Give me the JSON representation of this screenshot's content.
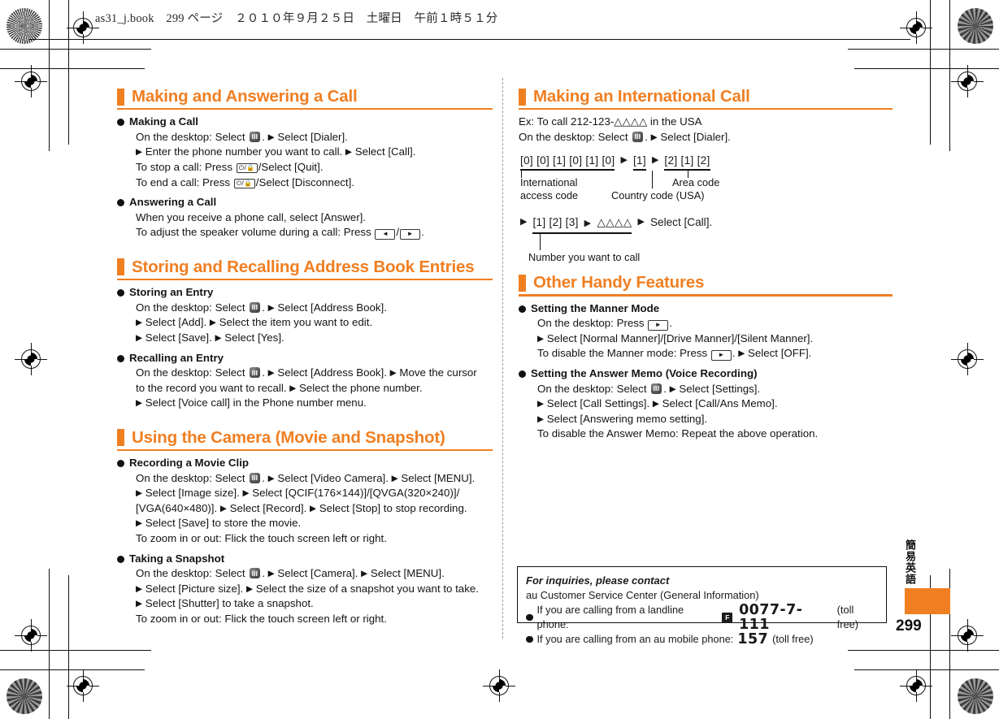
{
  "document": {
    "header_line": "as31_j.book　299 ページ　２０１０年９月２５日　土曜日　午前１時５１分",
    "page_number": "299",
    "side_tab_label": "簡易英語",
    "accent_color": "#F07F22"
  },
  "left_column": [
    {
      "heading": "Making and Answering a Call",
      "groups": [
        {
          "title": "Making a Call",
          "lines": [
            {
              "parts": [
                {
                  "t": "On the desktop: Select "
                },
                {
                  "icon": "menu-key"
                },
                {
                  "t": ". "
                },
                {
                  "tri": true
                },
                {
                  "t": " Select [Dialer]."
                }
              ]
            },
            {
              "parts": [
                {
                  "tri": true
                },
                {
                  "t": " Enter the phone number you want to call. "
                },
                {
                  "tri": true
                },
                {
                  "t": " Select [Call]."
                }
              ]
            },
            {
              "parts": [
                {
                  "t": "To stop a call: Press "
                },
                {
                  "icon": "power-key"
                },
                {
                  "t": "/Select [Quit]."
                }
              ]
            },
            {
              "parts": [
                {
                  "t": "To end a call: Press "
                },
                {
                  "icon": "power-key"
                },
                {
                  "t": "/Select [Disconnect]."
                }
              ]
            }
          ]
        },
        {
          "title": "Answering a Call",
          "lines": [
            {
              "parts": [
                {
                  "t": "When you receive a phone call, select [Answer]."
                }
              ]
            },
            {
              "parts": [
                {
                  "t": "To adjust the speaker volume during a call: Press "
                },
                {
                  "icon": "left-key"
                },
                {
                  "t": "/"
                },
                {
                  "icon": "right-key"
                },
                {
                  "t": "."
                }
              ]
            }
          ]
        }
      ]
    },
    {
      "heading": "Storing and Recalling Address Book Entries",
      "groups": [
        {
          "title": "Storing an Entry",
          "lines": [
            {
              "parts": [
                {
                  "t": "On the desktop: Select "
                },
                {
                  "icon": "menu-key"
                },
                {
                  "t": ". "
                },
                {
                  "tri": true
                },
                {
                  "t": " Select [Address Book]."
                }
              ]
            },
            {
              "parts": [
                {
                  "tri": true
                },
                {
                  "t": " Select [Add]. "
                },
                {
                  "tri": true
                },
                {
                  "t": " Select the item you want to edit."
                }
              ]
            },
            {
              "parts": [
                {
                  "tri": true
                },
                {
                  "t": " Select [Save]. "
                },
                {
                  "tri": true
                },
                {
                  "t": " Select [Yes]."
                }
              ]
            }
          ]
        },
        {
          "title": "Recalling an Entry",
          "lines": [
            {
              "parts": [
                {
                  "t": "On the desktop: Select "
                },
                {
                  "icon": "menu-key"
                },
                {
                  "t": ". "
                },
                {
                  "tri": true
                },
                {
                  "t": " Select [Address Book]. "
                },
                {
                  "tri": true
                },
                {
                  "t": " Move the cursor"
                }
              ]
            },
            {
              "parts": [
                {
                  "t": "to the record you want to recall. "
                },
                {
                  "tri": true
                },
                {
                  "t": " Select the phone number."
                }
              ]
            },
            {
              "parts": [
                {
                  "tri": true
                },
                {
                  "t": " Select [Voice call] in the Phone number menu."
                }
              ]
            }
          ]
        }
      ]
    },
    {
      "heading": "Using the Camera (Movie and Snapshot)",
      "groups": [
        {
          "title": "Recording a Movie Clip",
          "lines": [
            {
              "parts": [
                {
                  "t": "On the desktop: Select "
                },
                {
                  "icon": "menu-key"
                },
                {
                  "t": ". "
                },
                {
                  "tri": true
                },
                {
                  "t": " Select [Video Camera]. "
                },
                {
                  "tri": true
                },
                {
                  "t": " Select [MENU]."
                }
              ]
            },
            {
              "parts": [
                {
                  "tri": true
                },
                {
                  "t": " Select [Image size]. "
                },
                {
                  "tri": true
                },
                {
                  "t": " Select [QCIF(176×144)]/[QVGA(320×240)]/"
                }
              ]
            },
            {
              "parts": [
                {
                  "t": "[VGA(640×480)]. "
                },
                {
                  "tri": true
                },
                {
                  "t": " Select [Record]. "
                },
                {
                  "tri": true
                },
                {
                  "t": " Select [Stop] to stop recording."
                }
              ]
            },
            {
              "parts": [
                {
                  "tri": true
                },
                {
                  "t": " Select [Save] to store the movie."
                }
              ]
            },
            {
              "parts": [
                {
                  "t": "To zoom in or out: Flick the touch screen left or right."
                }
              ]
            }
          ]
        },
        {
          "title": "Taking a Snapshot",
          "lines": [
            {
              "parts": [
                {
                  "t": "On the desktop: Select "
                },
                {
                  "icon": "menu-key"
                },
                {
                  "t": ". "
                },
                {
                  "tri": true
                },
                {
                  "t": " Select [Camera]. "
                },
                {
                  "tri": true
                },
                {
                  "t": " Select [MENU]."
                }
              ]
            },
            {
              "parts": [
                {
                  "tri": true
                },
                {
                  "t": " Select [Picture size]. "
                },
                {
                  "tri": true
                },
                {
                  "t": " Select the size of a snapshot you want to take."
                }
              ]
            },
            {
              "parts": [
                {
                  "tri": true
                },
                {
                  "t": " Select [Shutter] to take a snapshot."
                }
              ]
            },
            {
              "parts": [
                {
                  "t": "To zoom in or out: Flick the touch screen left or right."
                }
              ]
            }
          ]
        }
      ]
    }
  ],
  "right_column": {
    "international": {
      "heading": "Making an International Call",
      "intro_lines": [
        {
          "parts": [
            {
              "t": "Ex: To call 212-123-△△△△ in the USA"
            }
          ]
        },
        {
          "parts": [
            {
              "t": "On the desktop: Select "
            },
            {
              "icon": "menu-key"
            },
            {
              "t": ". "
            },
            {
              "tri": true
            },
            {
              "t": " Select [Dialer]."
            }
          ]
        }
      ],
      "diagram": {
        "row1": [
          {
            "digits": "[0] [0] [1] [0] [1] [0]",
            "label": "International\naccess code",
            "label_align": "left"
          },
          {
            "digits": "[1]",
            "label": "Country code (USA)",
            "label_align": "center-low"
          },
          {
            "digits": "[2] [1] [2]",
            "label": "Area code",
            "label_align": "center"
          }
        ],
        "row2": [
          {
            "digits": "[1] [2] [3]",
            "label": "Number you want to call"
          },
          {
            "digits": "△△△△",
            "label": ""
          }
        ],
        "row2_tail": "Select [Call]."
      }
    },
    "handy": {
      "heading": "Other Handy Features",
      "groups": [
        {
          "title": "Setting the Manner Mode",
          "lines": [
            {
              "parts": [
                {
                  "t": "On the desktop: Press "
                },
                {
                  "icon": "right-key"
                },
                {
                  "t": "."
                }
              ]
            },
            {
              "parts": [
                {
                  "tri": true
                },
                {
                  "t": " Select [Normal Manner]/[Drive Manner]/[Silent Manner]."
                }
              ]
            },
            {
              "parts": [
                {
                  "t": "To disable the Manner mode: Press "
                },
                {
                  "icon": "right-key"
                },
                {
                  "t": ". "
                },
                {
                  "tri": true
                },
                {
                  "t": " Select [OFF]."
                }
              ]
            }
          ]
        },
        {
          "title": "Setting the Answer Memo (Voice Recording)",
          "lines": [
            {
              "parts": [
                {
                  "t": "On the desktop: Select "
                },
                {
                  "icon": "menu-key"
                },
                {
                  "t": ". "
                },
                {
                  "tri": true
                },
                {
                  "t": " Select [Settings]."
                }
              ]
            },
            {
              "parts": [
                {
                  "tri": true
                },
                {
                  "t": " Select [Call Settings]. "
                },
                {
                  "tri": true
                },
                {
                  "t": " Select [Call/Ans Memo]."
                }
              ]
            },
            {
              "parts": [
                {
                  "tri": true
                },
                {
                  "t": " Select [Answering memo setting]."
                }
              ]
            },
            {
              "parts": [
                {
                  "t": "To disable the Answer Memo: Repeat the above operation."
                }
              ]
            }
          ]
        }
      ]
    }
  },
  "inquiry_box": {
    "title": "For inquiries, please contact",
    "subtitle": "au Customer Service Center (General Information)",
    "rows": [
      {
        "text": "If you are calling from a landline phone:",
        "freemark": "F",
        "number": "0077-7-111",
        "note": "(toll free)"
      },
      {
        "text": "If you are calling from an au mobile phone:",
        "freemark": "",
        "number": "157",
        "note": "(toll free)"
      }
    ]
  },
  "icons": {
    "menu-key": "menu-key-icon",
    "power-key": "⏻/🔒",
    "left-key": "◄",
    "right-key": "►"
  }
}
